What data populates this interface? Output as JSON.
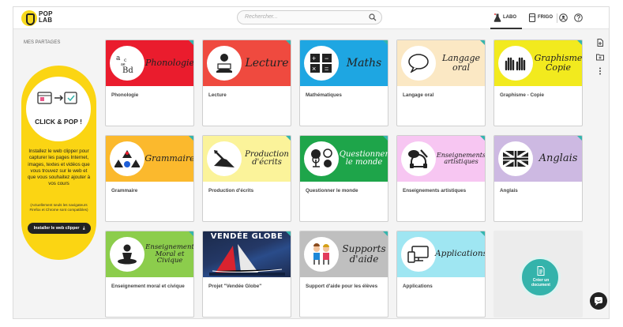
{
  "app": {
    "logo_text_line1": "POP",
    "logo_text_line2": "LAB"
  },
  "search": {
    "placeholder": "Rechercher..."
  },
  "nav": {
    "labo": "LABO",
    "frigo": "FRIGO"
  },
  "sidebar": {
    "heading": "MES PARTAGES",
    "promo": {
      "title": "CLICK & POP !",
      "description": "Installez le web clipper pour capturer les pages Internet, images, textes et vidéos que vous trouvez sur le web et que vous souhaitez ajouter à vos cours",
      "note": "(Actuellement seuls les navigateurs Firefox et Chrome sont compatibles)",
      "button": "Installer le web clipper"
    }
  },
  "cards": [
    {
      "label": "Phonologie",
      "script": "Phonologie",
      "color": "#ea1c2d",
      "icon": "letters-icon"
    },
    {
      "label": "Lecture",
      "script": "Lecture",
      "color": "#ef4a3f",
      "icon": "reading-person-icon"
    },
    {
      "label": "Mathématiques",
      "script": "Maths",
      "color": "#1ea6e2",
      "icon": "math-symbols-icon"
    },
    {
      "label": "Langage oral",
      "script": "Langage oral",
      "color": "#fbe8c4",
      "icon": "speech-bubble-icon"
    },
    {
      "label": "Graphisme - Copie",
      "script": "Graphisme Copie",
      "color": "#f2ea1e",
      "icon": "hands-icon"
    },
    {
      "label": "Grammaire",
      "script": "Grammaire",
      "color": "#fbb92d",
      "icon": "shapes-icon"
    },
    {
      "label": "Production d'écrits",
      "script": "Production d'écrits",
      "color": "#fbf39a",
      "icon": "writing-hand-icon"
    },
    {
      "label": "Questionner le monde",
      "script": "Questionner le monde",
      "color": "#1ea54a",
      "icon": "world-icon"
    },
    {
      "label": "Enseignements artistiques",
      "script": "Enseignements artistiques",
      "color": "#f7c6f2",
      "icon": "art-icon"
    },
    {
      "label": "Anglais",
      "script": "Anglais",
      "color": "#cdb9e2",
      "icon": "uk-flag-icon"
    },
    {
      "label": "Enseignement moral et civique",
      "script": "Enseignement Moral et Civique",
      "color": "#8ccd4c",
      "icon": "meditation-icon"
    },
    {
      "label": "Projet \"Vendée Globe\"",
      "script": "VENDÉE GLOBE",
      "color": "#1b2a4a",
      "icon": "sailboat-icon"
    },
    {
      "label": "Support d'aide pour les élèves",
      "script": "Supports d'aide",
      "color": "#bfbfbf",
      "icon": "children-icon"
    },
    {
      "label": "Applications",
      "script": "Applications",
      "color": "#9fe6f2",
      "icon": "devices-icon"
    }
  ],
  "fab": {
    "label": "Créer un document"
  },
  "colors": {
    "accent": "#34b3ab",
    "yellow": "#fbd513"
  }
}
